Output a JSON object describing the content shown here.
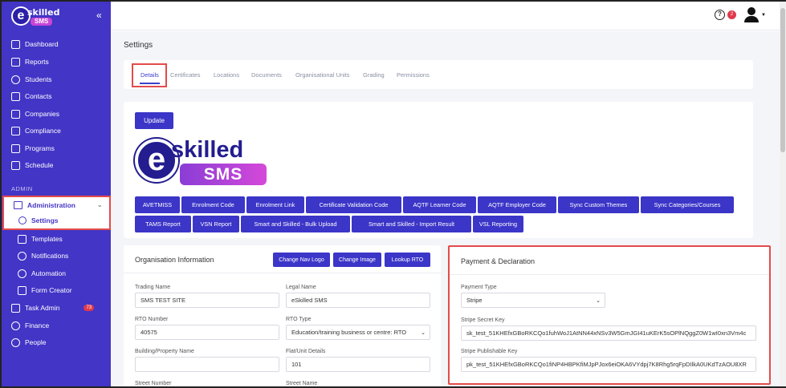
{
  "brand": {
    "logo_small_sk": "skilled",
    "logo_small_sms": "SMS",
    "logo_big_e": "e",
    "logo_big_sk": "skilled",
    "logo_big_sms": "SMS"
  },
  "sidebar": {
    "collapse_icon": "double-chevron-left-icon",
    "items": [
      {
        "label": "Dashboard"
      },
      {
        "label": "Reports"
      },
      {
        "label": "Students"
      },
      {
        "label": "Contacts"
      },
      {
        "label": "Companies"
      },
      {
        "label": "Compliance"
      },
      {
        "label": "Programs"
      },
      {
        "label": "Schedule"
      }
    ],
    "section_label": "ADMIN",
    "admin": {
      "label": "Administration",
      "settings_label": "Settings"
    },
    "sub_items": [
      {
        "label": "Templates"
      },
      {
        "label": "Notifications"
      },
      {
        "label": "Automation"
      },
      {
        "label": "Form Creator"
      }
    ],
    "task_admin": {
      "label": "Task Admin",
      "badge": "73"
    },
    "finance": {
      "label": "Finance"
    },
    "people": {
      "label": "People"
    }
  },
  "topbar": {
    "help": "?",
    "notif_count": "2"
  },
  "page": {
    "title": "Settings"
  },
  "tabs": [
    {
      "label": "Details"
    },
    {
      "label": "Certificates"
    },
    {
      "label": "Locations"
    },
    {
      "label": "Documents"
    },
    {
      "label": "Organisational Units"
    },
    {
      "label": "Grading"
    },
    {
      "label": "Permissions"
    }
  ],
  "content": {
    "update_label": "Update",
    "buttons_row1": [
      "AVETMISS",
      "Enrolment Code",
      "Enrolment Link",
      "Certificate Validation Code",
      "AQTF Learner Code",
      "AQTF Employer Code",
      "Sync Custom Themes",
      "Sync Categories/Courses"
    ],
    "buttons_row2": [
      "TAMS Report",
      "VSN Report",
      "Smart and Skilled - Bulk Upload",
      "Smart and Skilled - Import Result",
      "VSL Reporting"
    ]
  },
  "org": {
    "title": "Organisation Information",
    "change_nav_logo": "Change Nav Logo",
    "change_image": "Change Image",
    "lookup_rto": "Lookup RTO",
    "trading_name_label": "Trading Name",
    "trading_name": "SMS TEST SITE",
    "legal_name_label": "Legal Name",
    "legal_name": "eSkilled SMS",
    "rto_number_label": "RTO Number",
    "rto_number": "40575",
    "rto_type_label": "RTO Type",
    "rto_type": "Education/training business or centre: RTO",
    "building_label": "Building/Property Name",
    "building": "",
    "flat_label": "Flat/Unit Details",
    "flat": "101",
    "street_number_label": "Street Number",
    "street_name_label": "Street Name"
  },
  "payment": {
    "title": "Payment & Declaration",
    "type_label": "Payment Type",
    "type": "Stripe",
    "secret_label": "Stripe Secret Key",
    "secret": "sk_test_51KHEfxGBoRKCQo1fuhWoJ1AtNN44xNSv3W5GmJGI41uKErK5sOPlNQggZ0W1wI0xn3Vm4c",
    "publishable_label": "Stripe Publishable Key",
    "publishable": "pk_test_51KHEfxGBoRKCQo1fiNP4HBPKfiMJpPJox6eiOKA6VYdpj7K8Rhg5rqFpDIlkA0UKdTzAOU8XR"
  }
}
